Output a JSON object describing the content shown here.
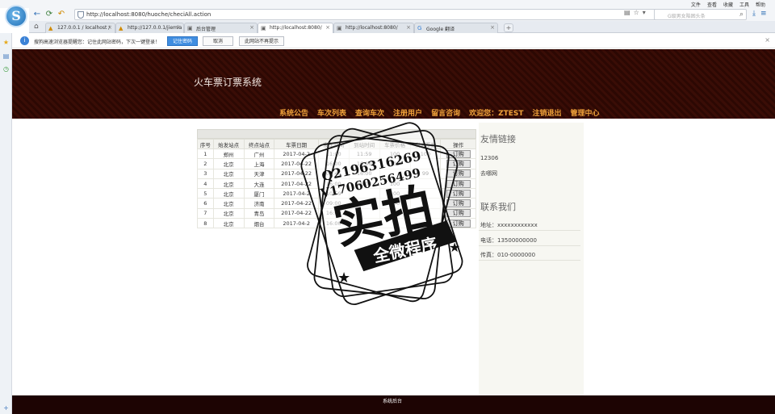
{
  "browser": {
    "menu": [
      "文件",
      "查看",
      "收藏",
      "工具",
      "帮助"
    ],
    "url": "http://localhost:8080/huoche/checiAll.action",
    "search_placeholder": "G级男女陷困头条",
    "tabs": [
      {
        "label": "127.0.0.1 / localhost /"
      },
      {
        "label": "http://127.0.0.1/jiemia"
      },
      {
        "label": "后台管理"
      },
      {
        "label": "http://localhost:8080/"
      },
      {
        "label": "http://localhost:8080/"
      },
      {
        "label": "Google 翻译"
      }
    ]
  },
  "password_bar": {
    "message": "搜狗高速浏览器提醒您：记住此网站密码，下次一键登录！",
    "remember": "记住密码",
    "cancel": "取消",
    "never": "此网站不再提示"
  },
  "site": {
    "title": "火车票订票系统",
    "nav": [
      "系统公告",
      "车次列表",
      "查询车次",
      "注册用户",
      "留言咨询",
      "欢迎您：ZTEST",
      "注销退出",
      "管理中心"
    ],
    "footer": "系统后台"
  },
  "table": {
    "headers": [
      "序号",
      "始发站点",
      "终点站点",
      "车票日期",
      "发车时间",
      "到站时间",
      "车票价格",
      "剩余票数",
      "操作"
    ],
    "action_label": "订购",
    "rows": [
      [
        "1",
        "郑州",
        "广州",
        "2017-04-2",
        "11:00",
        "11:59",
        "100",
        "100"
      ],
      [
        "2",
        "北京",
        "上海",
        "2017-04-22",
        "16:00",
        "16:00",
        "100",
        ""
      ],
      [
        "3",
        "北京",
        "天津",
        "2017-04-22",
        "09:45",
        "16:00",
        "",
        "99"
      ],
      [
        "4",
        "北京",
        "大连",
        "2017-04-22",
        "16:00",
        "16:00",
        "100",
        ""
      ],
      [
        "5",
        "北京",
        "厦门",
        "2017-04-2",
        "10:59",
        "",
        "100",
        ""
      ],
      [
        "6",
        "北京",
        "济南",
        "2017-04-22",
        "09:00",
        "",
        "100",
        ""
      ],
      [
        "7",
        "北京",
        "青岛",
        "2017-04-22",
        "16:00",
        "",
        "100",
        ""
      ],
      [
        "8",
        "北京",
        "烟台",
        "2017-04-2",
        "16:00",
        "",
        "",
        ""
      ]
    ]
  },
  "sidebar": {
    "links_title": "友情链接",
    "links": [
      "12306",
      "去哪网"
    ],
    "contact_title": "联系我们",
    "contact": [
      "地址：xxxxxxxxxxxx",
      "电话：13500000000",
      "传真：010-0000000"
    ]
  },
  "watermark": {
    "qq": "Q2196316269",
    "wechat": "V17060256499",
    "main": "实拍",
    "banner": "全微程序"
  }
}
